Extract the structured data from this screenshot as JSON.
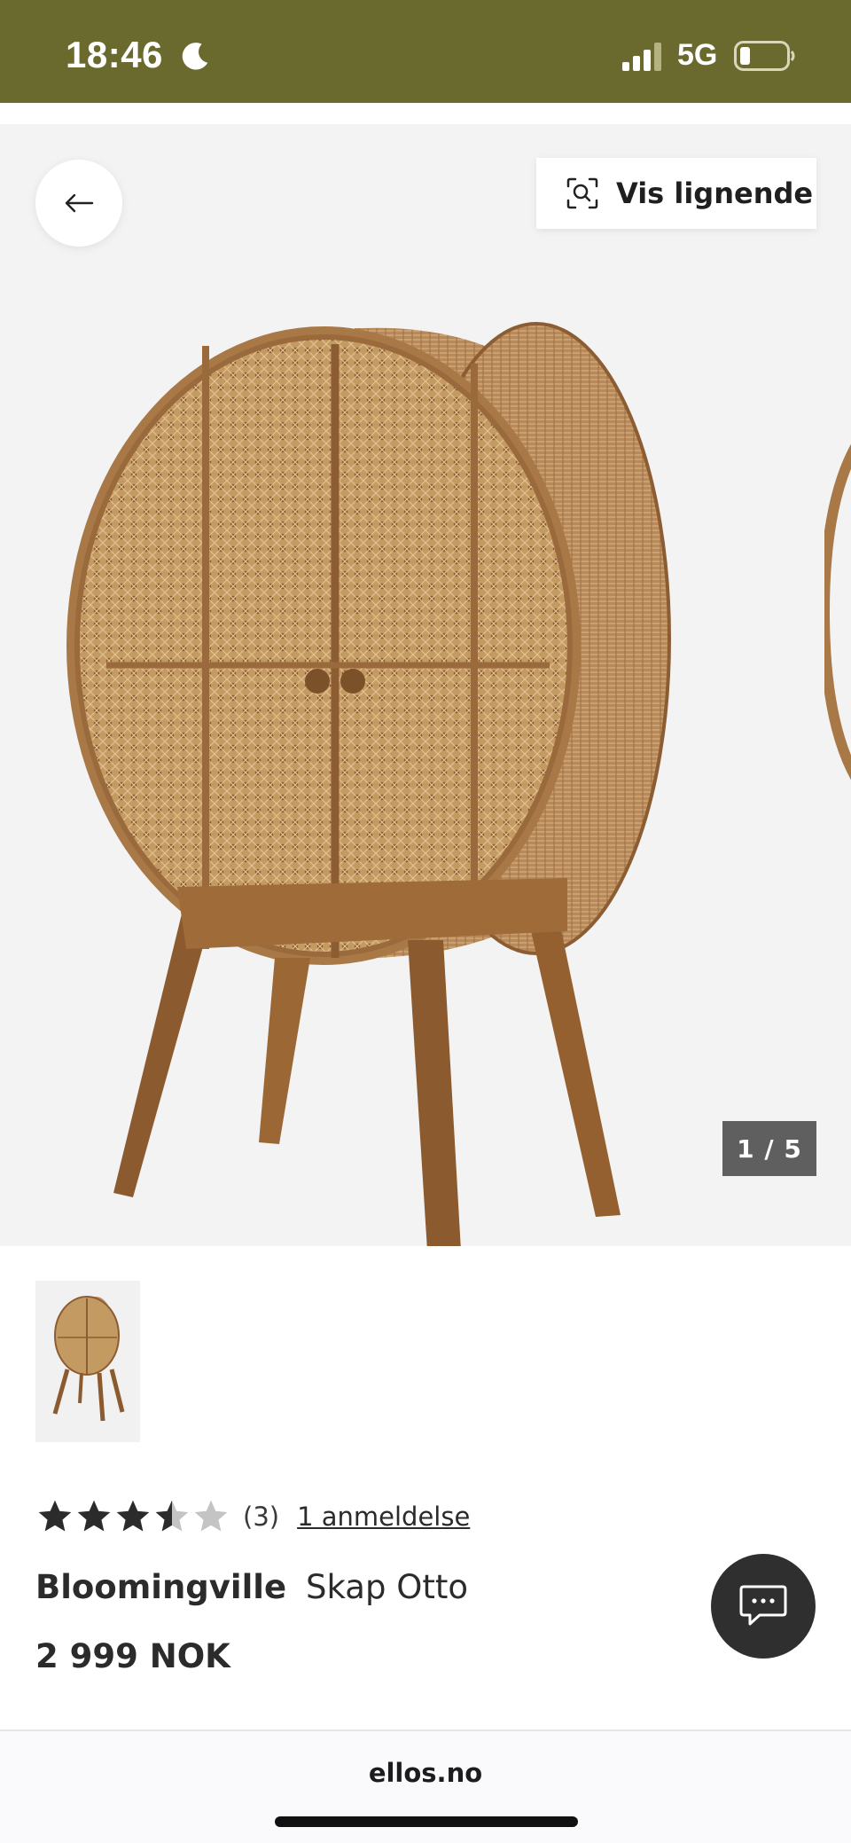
{
  "status_bar": {
    "time": "18:46",
    "network": "5G",
    "signal_icon": "signal-bars-icon",
    "moon_icon": "moon-icon",
    "battery_icon": "battery-icon",
    "background_color": "#6b6a2e"
  },
  "gallery": {
    "similar_button_label": "Vis lignende",
    "similar_icon": "visual-search-icon",
    "back_icon": "arrow-left-icon",
    "counter": "1 / 5",
    "background_color": "#f3f3f4"
  },
  "product": {
    "rating": 3.5,
    "rating_max": 5,
    "review_count": "(3)",
    "reviews_link": "1 anmeldelse",
    "brand": "Bloomingville",
    "name": "Skap Otto",
    "price": "2 999 NOK"
  },
  "chat": {
    "icon": "chat-bubble-icon"
  },
  "browser": {
    "url": "ellos.no"
  }
}
